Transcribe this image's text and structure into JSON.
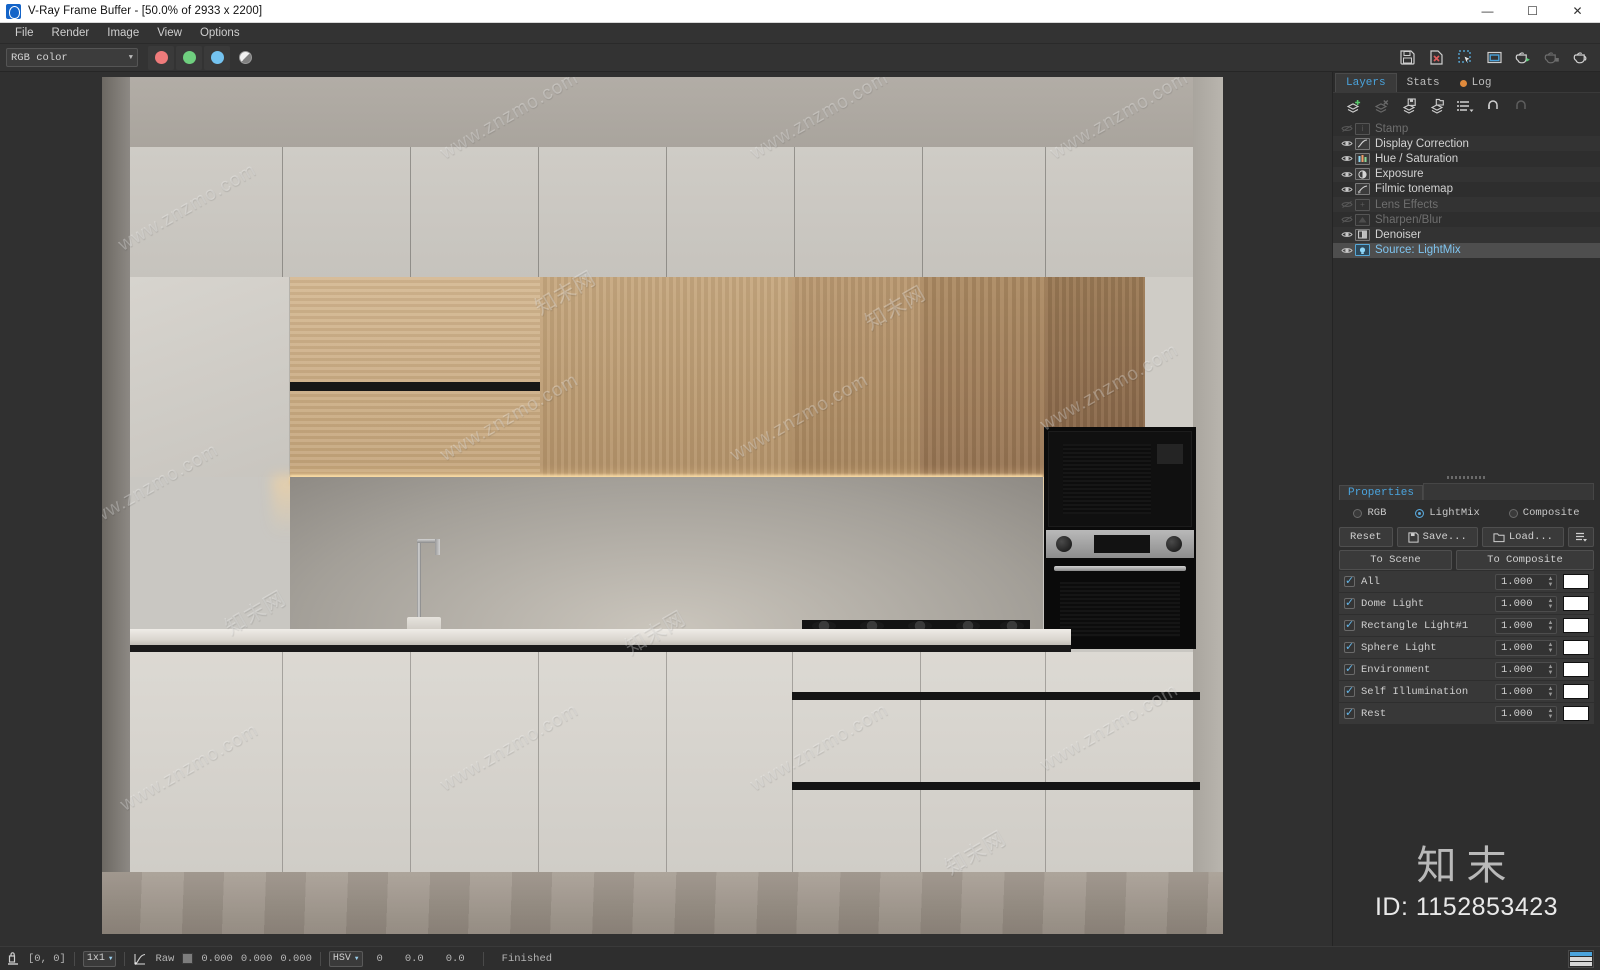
{
  "window": {
    "title": "V-Ray Frame Buffer - [50.0% of 2933 x 2200]",
    "app_icon": "vray-logo-icon",
    "controls": {
      "minimize": "—",
      "maximize": "☐",
      "close": "✕"
    }
  },
  "menubar": {
    "items": [
      {
        "label": "File"
      },
      {
        "label": "Render"
      },
      {
        "label": "Image"
      },
      {
        "label": "View"
      },
      {
        "label": "Options"
      }
    ]
  },
  "toolbar": {
    "channel_select": {
      "value": "RGB color",
      "arrow": "▼"
    },
    "channels": [
      {
        "name": "red-channel-button",
        "icon": "red-dot-icon"
      },
      {
        "name": "green-channel-button",
        "icon": "green-dot-icon"
      },
      {
        "name": "blue-channel-button",
        "icon": "blue-dot-icon"
      },
      {
        "name": "alpha-channel-button",
        "icon": "alpha-circle-icon"
      }
    ],
    "right_buttons": [
      {
        "name": "save-image-button",
        "icon": "floppy-disk-icon"
      },
      {
        "name": "clear-image-button",
        "icon": "file-delete-icon"
      },
      {
        "name": "region-render-button",
        "icon": "marquee-cursor-icon"
      },
      {
        "name": "viewport-button",
        "icon": "panel-window-icon"
      },
      {
        "name": "render-last-button",
        "icon": "teapot-play-icon"
      },
      {
        "name": "stop-render-button",
        "icon": "teapot-stop-icon"
      },
      {
        "name": "render-button",
        "icon": "teapot-icon"
      }
    ]
  },
  "dock": {
    "tabs": [
      {
        "label": "Layers",
        "active": true
      },
      {
        "label": "Stats",
        "active": false
      },
      {
        "label": "Log",
        "active": false,
        "has_indicator": true
      }
    ],
    "layer_tools": [
      {
        "name": "add-layer-button",
        "icon": "layer-add-icon"
      },
      {
        "name": "delete-layer-button",
        "icon": "layer-delete-icon"
      },
      {
        "name": "save-layers-button",
        "icon": "layer-save-icon"
      },
      {
        "name": "load-layers-button",
        "icon": "layer-load-icon"
      },
      {
        "name": "layer-presets-button",
        "icon": "list-menu-icon"
      },
      {
        "name": "undo-button",
        "icon": "undo-arrow-icon"
      },
      {
        "name": "redo-button",
        "icon": "redo-arrow-icon"
      }
    ],
    "layers": [
      {
        "label": "Stamp",
        "icon": "stamp-icon",
        "visible": false,
        "enabled": false,
        "selected": false
      },
      {
        "label": "Display Correction",
        "icon": "curve-icon",
        "visible": true,
        "enabled": true,
        "selected": false
      },
      {
        "label": "Hue / Saturation",
        "icon": "hue-bars-icon",
        "visible": true,
        "enabled": true,
        "selected": false
      },
      {
        "label": "Exposure",
        "icon": "contrast-icon",
        "visible": true,
        "enabled": true,
        "selected": false
      },
      {
        "label": "Filmic tonemap",
        "icon": "filmic-curve-icon",
        "visible": true,
        "enabled": true,
        "selected": false
      },
      {
        "label": "Lens Effects",
        "icon": "lens-plus-icon",
        "visible": false,
        "enabled": false,
        "selected": false
      },
      {
        "label": "Sharpen/Blur",
        "icon": "sharpen-icon",
        "visible": false,
        "enabled": false,
        "selected": false
      },
      {
        "label": "Denoiser",
        "icon": "denoise-icon",
        "visible": true,
        "enabled": true,
        "selected": false
      },
      {
        "label": "Source: LightMix",
        "icon": "lightbulb-icon",
        "visible": true,
        "enabled": true,
        "selected": true
      }
    ],
    "properties": {
      "title": "Properties",
      "modes": [
        {
          "label": "RGB",
          "selected": false
        },
        {
          "label": "LightMix",
          "selected": true
        },
        {
          "label": "Composite",
          "selected": false
        }
      ],
      "buttons": [
        {
          "label": "Reset",
          "name": "reset-button",
          "icon": ""
        },
        {
          "label": "Save...",
          "name": "save-button",
          "icon": "floppy-disk-icon"
        },
        {
          "label": "Load...",
          "name": "load-button",
          "icon": "folder-open-icon"
        },
        {
          "label": "",
          "name": "presets-menu-button",
          "icon": "list-menu-icon"
        }
      ],
      "action_buttons": [
        {
          "label": "To Scene",
          "name": "to-scene-button"
        },
        {
          "label": "To Composite",
          "name": "to-composite-button"
        }
      ],
      "lightmix_rows": [
        {
          "label": "All",
          "checked": true,
          "value": "1.000",
          "color": "#ffffff"
        },
        {
          "label": "Dome Light",
          "checked": true,
          "value": "1.000",
          "color": "#ffffff"
        },
        {
          "label": "Rectangle Light#1",
          "checked": true,
          "value": "1.000",
          "color": "#ffffff"
        },
        {
          "label": "Sphere Light",
          "checked": true,
          "value": "1.000",
          "color": "#ffffff"
        },
        {
          "label": "Environment",
          "checked": true,
          "value": "1.000",
          "color": "#ffffff"
        },
        {
          "label": "Self Illumination",
          "checked": true,
          "value": "1.000",
          "color": "#ffffff"
        },
        {
          "label": "Rest",
          "checked": true,
          "value": "1.000",
          "color": "#ffffff"
        }
      ]
    },
    "watermark": {
      "cn": "知末",
      "id": "ID: 1152853423"
    }
  },
  "statusbar": {
    "pixel_icon": "pixel-probe-icon",
    "coords": "[0,  0]",
    "sample_size": {
      "value": "1x1",
      "arrow": "▼"
    },
    "curve_icon": "curve-icon",
    "raw_label": "Raw",
    "color_swatch": "#7d7d7d",
    "rgb_values": [
      "0.000",
      "0.000",
      "0.000"
    ],
    "color_space": {
      "value": "HSV",
      "arrow": "▼"
    },
    "hsv_values": [
      "0",
      "0.0",
      "0.0"
    ],
    "render_status": "Finished",
    "histogram_icon": "mini-histogram-icon"
  },
  "render_image": {
    "description": "Modern kitchen interior render",
    "watermarks": [
      "www.znzmo.com",
      "www.znzmo.com",
      "www.znzmo.com",
      "www.znzmo.com",
      "www.znzmo.com",
      "www.znzmo.com",
      "www.znzmo.com",
      "www.znzmo.com",
      "www.znzmo.com",
      "www.znzmo.com",
      "www.znzmo.com",
      "www.znzmo.com"
    ],
    "cn_watermarks": [
      "知末网",
      "知末网",
      "知末网",
      "知末网",
      "知末网"
    ]
  }
}
